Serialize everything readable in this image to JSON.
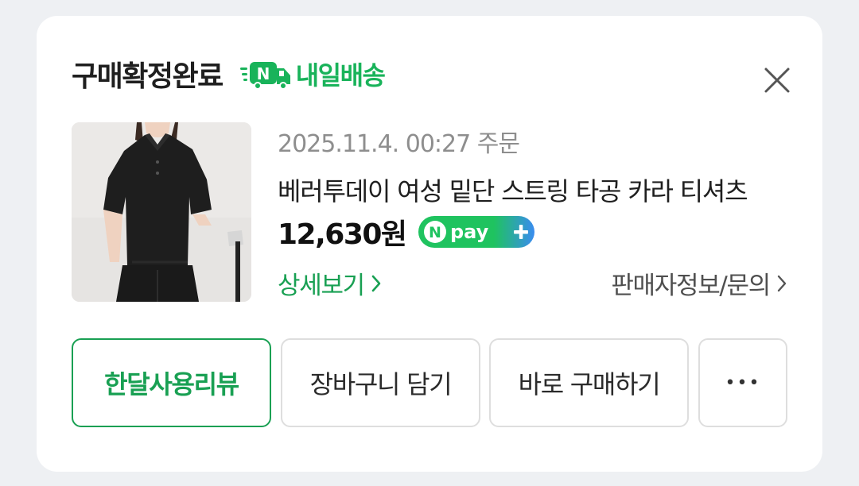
{
  "header": {
    "status": "구매확정완료",
    "delivery_badge": "내일배송",
    "delivery_icon_letter": "N"
  },
  "close_icon": "close-icon",
  "order": {
    "date": "2025.11.4. 00:27 주문",
    "title": "베러투데이 여성 밑단 스트링 타공 카라 티셔츠",
    "price": "12,630원",
    "npay_label": "pay",
    "npay_letter": "N",
    "detail_link": "상세보기",
    "seller_link": "판매자정보/문의"
  },
  "actions": {
    "review": "한달사용리뷰",
    "cart": "장바구니 담기",
    "buy_now": "바로 구매하기",
    "more": "•••"
  },
  "colors": {
    "accent": "#19a053",
    "delivery": "#19b35a",
    "npay_green": "#1fc35f",
    "npay_blue": "#3a8cf0"
  }
}
